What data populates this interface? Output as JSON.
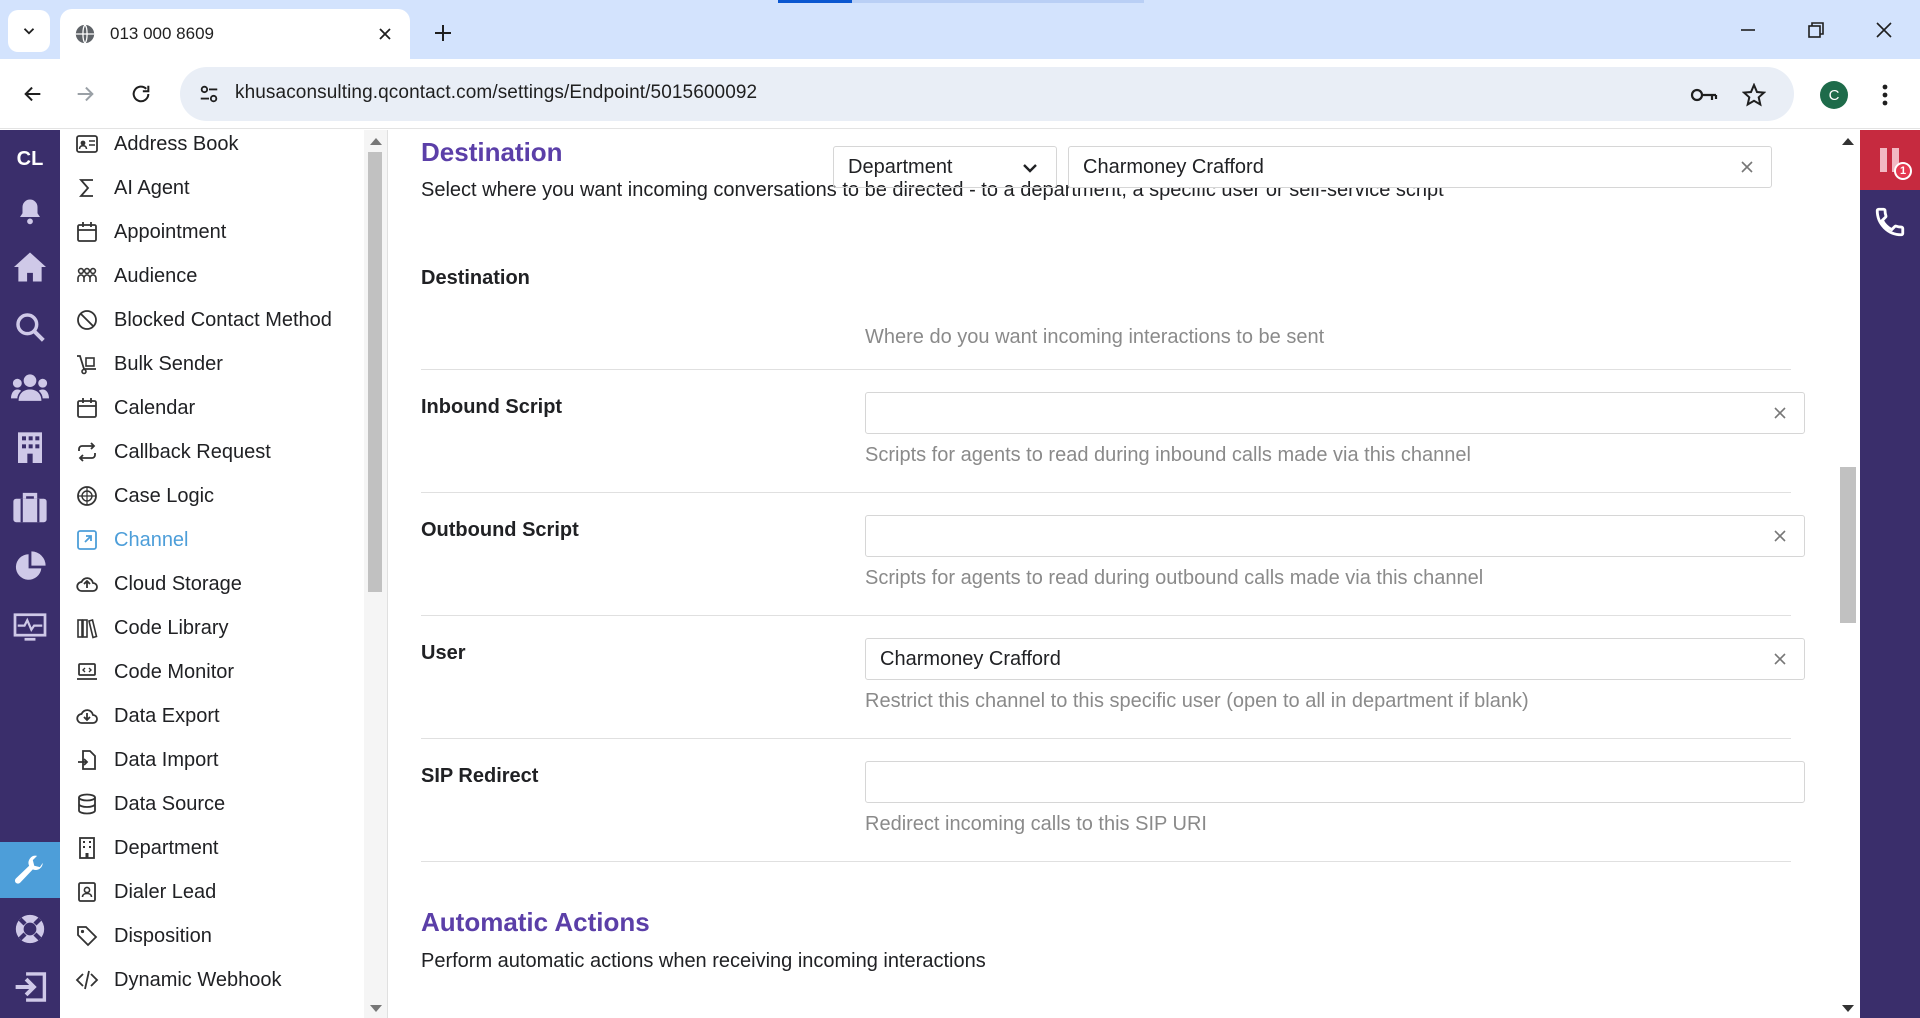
{
  "browser": {
    "tab_title": "013 000 8609",
    "url": "khusaconsulting.qcontact.com/settings/Endpoint/5015600092",
    "profile_initial": "C"
  },
  "rail": {
    "logo": "CL",
    "items": [
      "bell-icon",
      "home-icon",
      "search-icon",
      "users-icon",
      "building-icon",
      "briefcase-icon",
      "pie-chart-icon",
      "monitor-icon",
      "wrench-icon",
      "lifebuoy-icon",
      "logout-icon"
    ]
  },
  "settings_nav": {
    "items": [
      {
        "label": "Address Book",
        "icon": "address-card-icon"
      },
      {
        "label": "AI Agent",
        "icon": "sigma-icon"
      },
      {
        "label": "Appointment",
        "icon": "calendar-icon"
      },
      {
        "label": "Audience",
        "icon": "group-icon"
      },
      {
        "label": "Blocked Contact Method",
        "icon": "blocked-icon"
      },
      {
        "label": "Bulk Sender",
        "icon": "dolly-icon"
      },
      {
        "label": "Calendar",
        "icon": "calendar-icon"
      },
      {
        "label": "Callback Request",
        "icon": "repeat-icon"
      },
      {
        "label": "Case Logic",
        "icon": "globe-icon"
      },
      {
        "label": "Channel",
        "icon": "external-link-icon"
      },
      {
        "label": "Cloud Storage",
        "icon": "cloud-upload-icon"
      },
      {
        "label": "Code Library",
        "icon": "books-icon"
      },
      {
        "label": "Code Monitor",
        "icon": "laptop-code-icon"
      },
      {
        "label": "Data Export",
        "icon": "cloud-download-icon"
      },
      {
        "label": "Data Import",
        "icon": "file-import-icon"
      },
      {
        "label": "Data Source",
        "icon": "database-icon"
      },
      {
        "label": "Department",
        "icon": "building-icon"
      },
      {
        "label": "Dialer Lead",
        "icon": "contact-icon"
      },
      {
        "label": "Disposition",
        "icon": "tag-icon"
      },
      {
        "label": "Dynamic Webhook",
        "icon": "code-icon"
      }
    ],
    "active_label": "Channel"
  },
  "destination_section": {
    "title": "Destination",
    "description": "Select where you want incoming conversations to be directed - to a department, a specific user or self-service script"
  },
  "fields": {
    "destination": {
      "label": "Destination",
      "type_value": "Department",
      "value": "Charmoney Crafford",
      "help": "Where do you want incoming interactions to be sent"
    },
    "inbound_script": {
      "label": "Inbound Script",
      "value": "",
      "help": "Scripts for agents to read during inbound calls made via this channel"
    },
    "outbound_script": {
      "label": "Outbound Script",
      "value": "",
      "help": "Scripts for agents to read during outbound calls made via this channel"
    },
    "user": {
      "label": "User",
      "value": "Charmoney Crafford",
      "help": "Restrict this channel to this specific user (open to all in department if blank)"
    },
    "sip_redirect": {
      "label": "SIP Redirect",
      "value": "",
      "help": "Redirect incoming calls to this SIP URI"
    }
  },
  "automatic_actions_section": {
    "title": "Automatic Actions",
    "description": "Perform automatic actions when receiving incoming interactions"
  },
  "right_rail": {
    "notification_count": "1"
  },
  "colors": {
    "rail_bg": "#3a2e6b",
    "accent_purple": "#5b3fa8",
    "active_blue": "#4d9ed9",
    "alert_red": "#c62a3f"
  }
}
